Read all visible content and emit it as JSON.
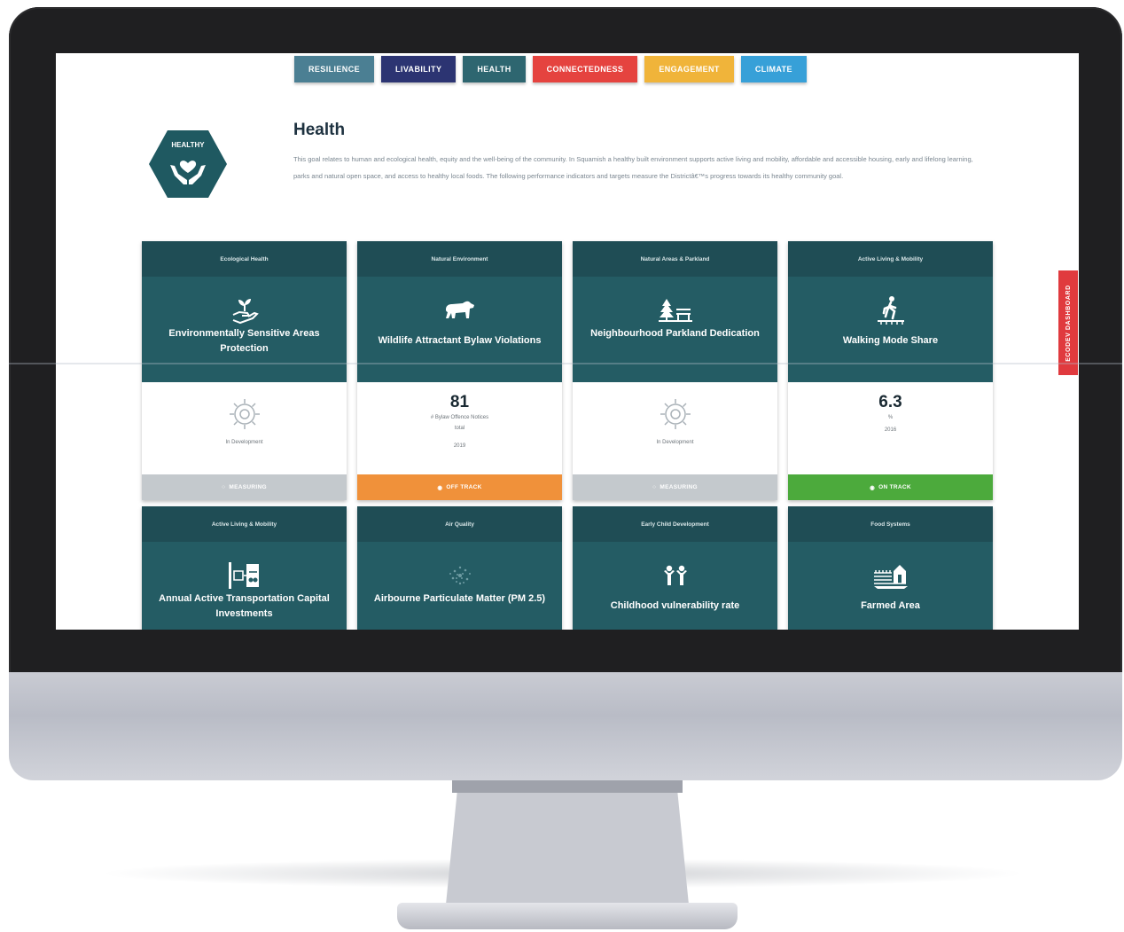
{
  "tabs": [
    {
      "label": "RESILIENCE",
      "color": "#4b7f93"
    },
    {
      "label": "LIVABILITY",
      "color": "#2c3472"
    },
    {
      "label": "HEALTH",
      "color": "#2e6670"
    },
    {
      "label": "CONNECTEDNESS",
      "color": "#e5433f"
    },
    {
      "label": "ENGAGEMENT",
      "color": "#f0b43a"
    },
    {
      "label": "CLIMATE",
      "color": "#37a0d8"
    }
  ],
  "badge": {
    "label": "HEALTHY",
    "icon": "hands-heart-icon",
    "color": "#1f5961"
  },
  "goal": {
    "title": "Health",
    "description": "This goal relates to human and ecological health, equity and the well-being of the community. In Squamish a healthy built environment supports active living and mobility, affordable and accessible housing, early and lifelong learning, parks and natural open space, and access to healthy local foods. The following performance indicators and targets measure the Districtâ€™s progress towards its healthy community goal."
  },
  "side_tab": {
    "label": "ECODEV DASHBOARD",
    "color": "#e03a3e"
  },
  "cards_row1": [
    {
      "category": "Ecological Health",
      "icon": "hand-sprout-icon",
      "name": "Environmentally Sensitive Areas Protection",
      "status_type": "in-development",
      "status_text": "In Development",
      "status": "MEASURING",
      "status_color": "#c4c9cd"
    },
    {
      "category": "Natural Environment",
      "icon": "bear-icon",
      "name": "Wildlife Attractant Bylaw Violations",
      "value": "81",
      "unit": "# Bylaw Offence Notices",
      "qualifier": "total",
      "year": "2019",
      "status": "OFF TRACK",
      "status_color": "#f0913a"
    },
    {
      "category": "Natural Areas & Parkland",
      "icon": "park-bench-icon",
      "name": "Neighbourhood Parkland Dedication",
      "status_type": "in-development",
      "status_text": "In Development",
      "status": "MEASURING",
      "status_color": "#c4c9cd"
    },
    {
      "category": "Active Living & Mobility",
      "icon": "walking-icon",
      "name": "Walking Mode Share",
      "value": "6.3",
      "unit": "%",
      "year": "2016",
      "status": "ON TRACK",
      "status_color": "#4caa3c"
    }
  ],
  "cards_row2": [
    {
      "category": "Active Living & Mobility",
      "icon": "transit-icon",
      "name": "Annual Active Transportation Capital Investments"
    },
    {
      "category": "Air Quality",
      "icon": "particulate-icon",
      "name": "Airbourne Particulate Matter (PM 2.5)"
    },
    {
      "category": "Early Child Development",
      "icon": "children-icon",
      "name": "Childhood vulnerability rate"
    },
    {
      "category": "Food Systems",
      "icon": "farm-icon",
      "name": "Farmed Area"
    }
  ]
}
